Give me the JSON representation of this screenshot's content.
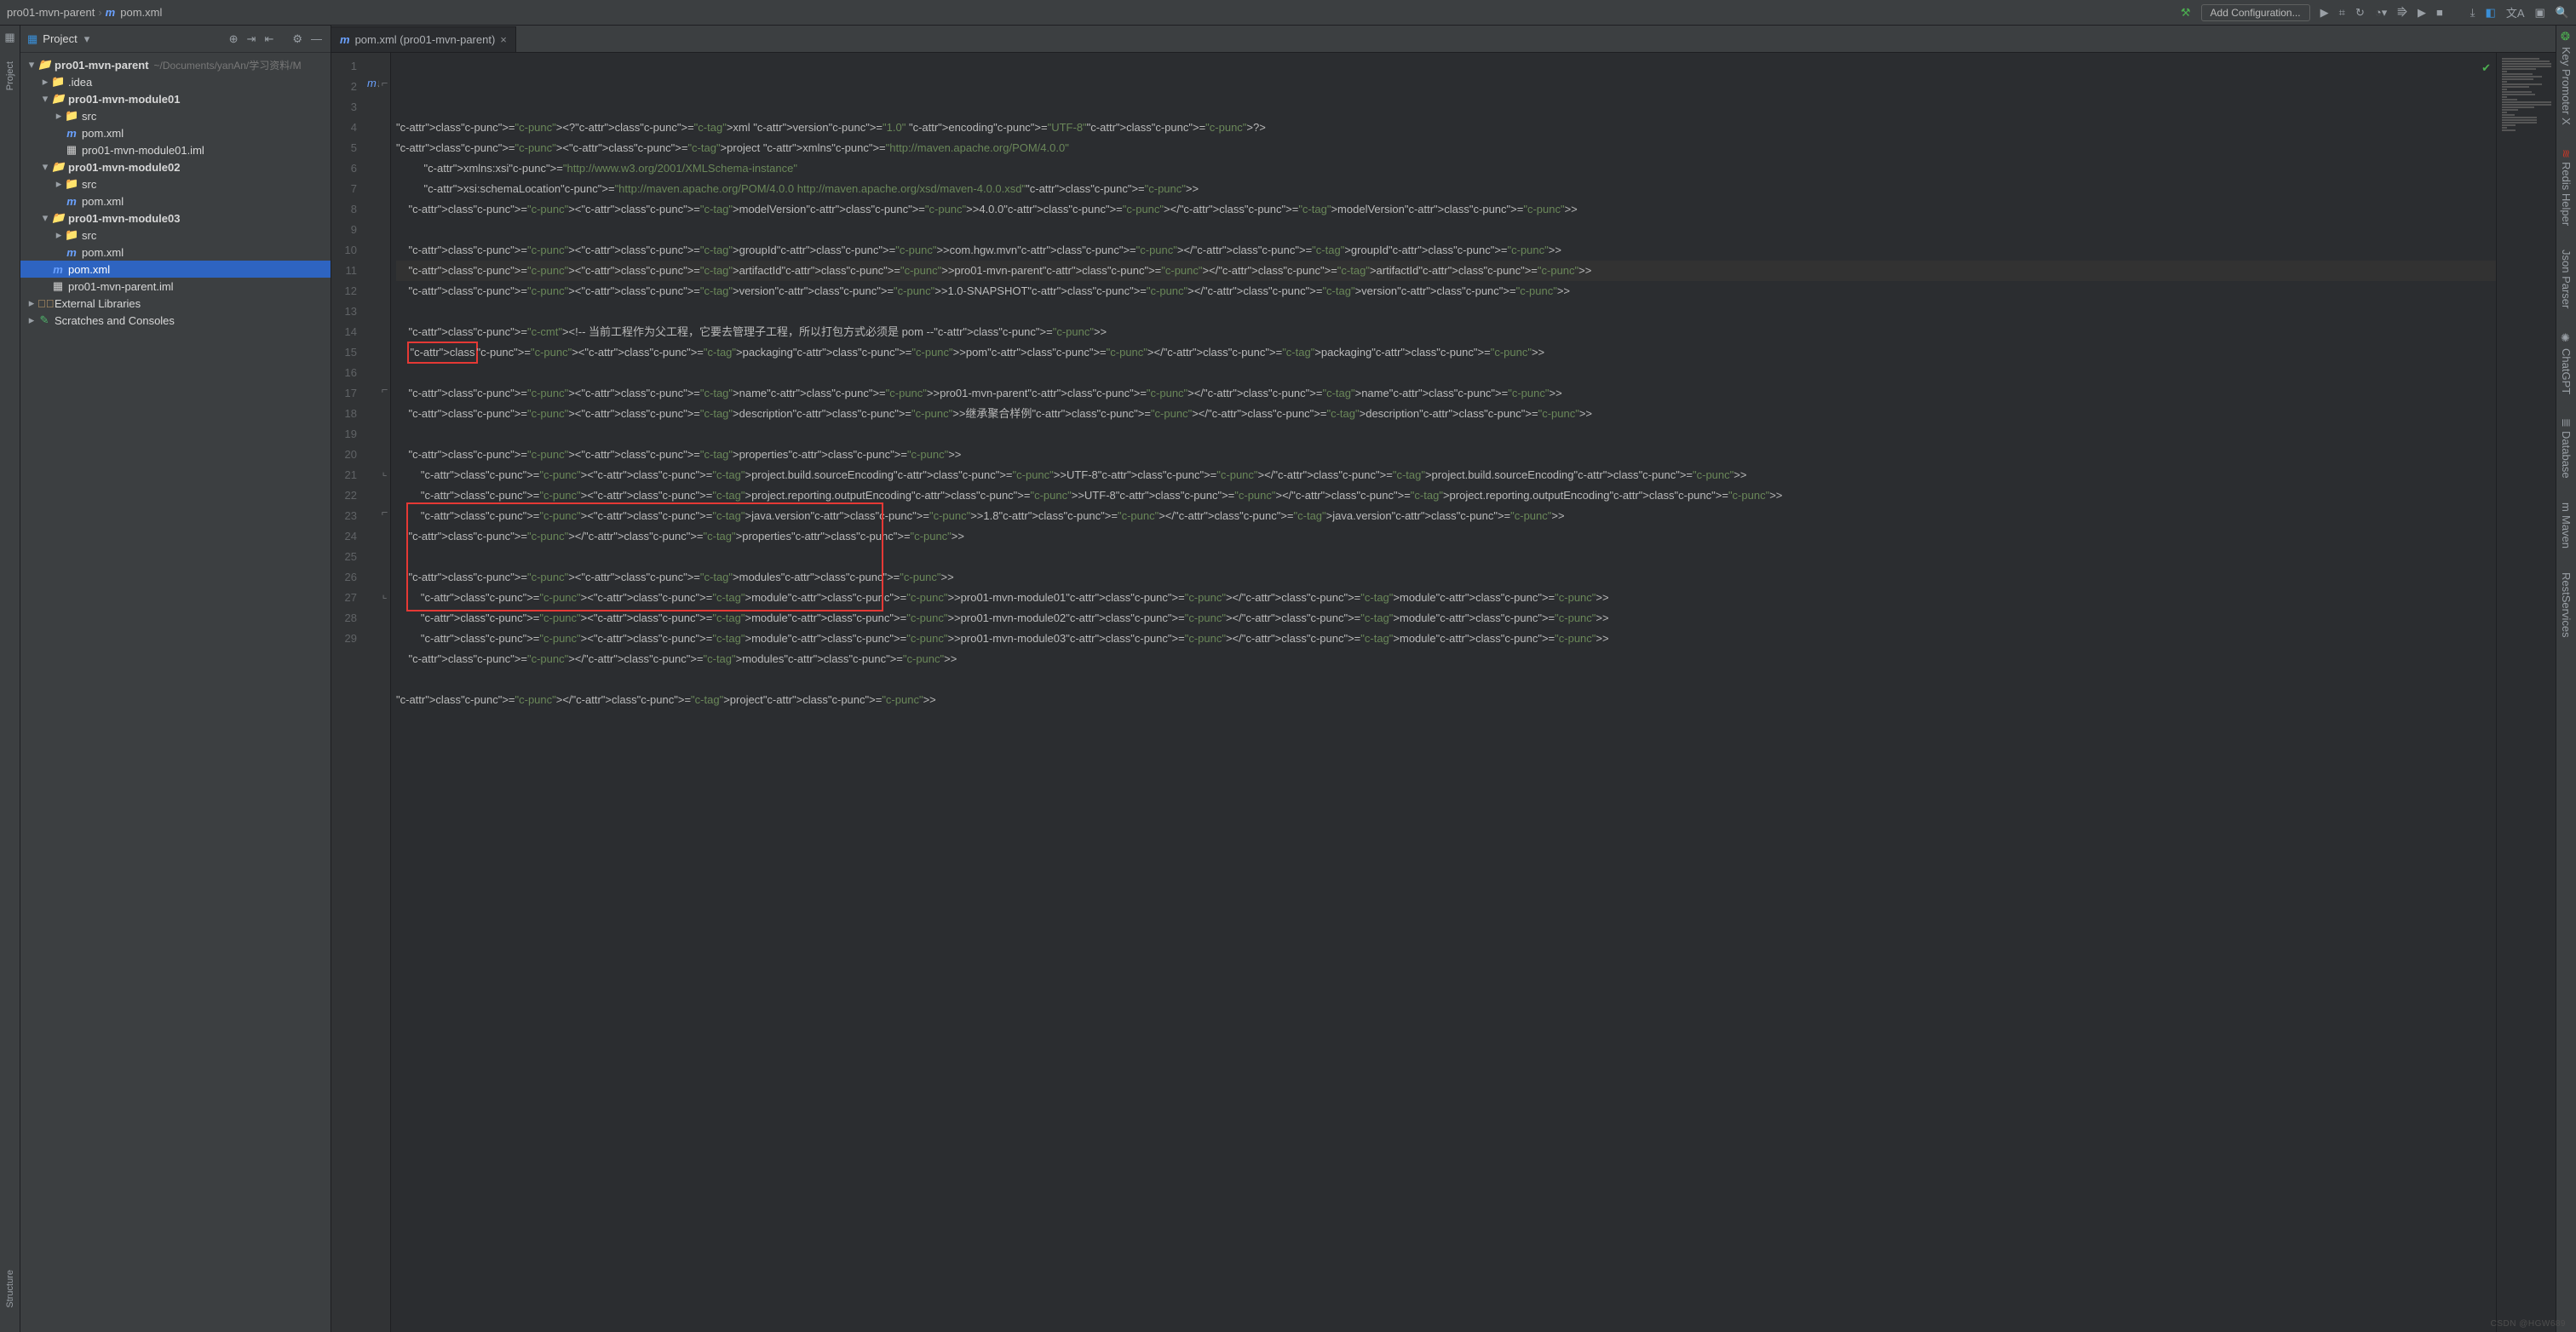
{
  "breadcrumb": {
    "root": "pro01-mvn-parent",
    "file": "pom.xml"
  },
  "toolbar": {
    "add_config": "Add Configuration..."
  },
  "sidebar": {
    "title": "Project",
    "root": {
      "name": "pro01-mvn-parent",
      "hint": "~/Documents/yanAn/学习资料/M"
    },
    "items": [
      {
        "type": "arrow-open",
        "indent": 0,
        "icon": "mod",
        "label": "pro01-mvn-parent",
        "bold": true,
        "hint": "~/Documents/yanAn/学习资料/M"
      },
      {
        "type": "arrow-closed",
        "indent": 1,
        "icon": "folder",
        "label": ".idea"
      },
      {
        "type": "arrow-open",
        "indent": 1,
        "icon": "mod",
        "label": "pro01-mvn-module01",
        "bold": true
      },
      {
        "type": "arrow-closed",
        "indent": 2,
        "icon": "folder",
        "label": "src"
      },
      {
        "type": "leaf",
        "indent": 2,
        "icon": "m",
        "label": "pom.xml"
      },
      {
        "type": "leaf",
        "indent": 2,
        "icon": "i",
        "label": "pro01-mvn-module01.iml"
      },
      {
        "type": "arrow-open",
        "indent": 1,
        "icon": "mod",
        "label": "pro01-mvn-module02",
        "bold": true
      },
      {
        "type": "arrow-closed",
        "indent": 2,
        "icon": "folder",
        "label": "src"
      },
      {
        "type": "leaf",
        "indent": 2,
        "icon": "m",
        "label": "pom.xml"
      },
      {
        "type": "arrow-open",
        "indent": 1,
        "icon": "mod",
        "label": "pro01-mvn-module03",
        "bold": true
      },
      {
        "type": "arrow-closed",
        "indent": 2,
        "icon": "folder",
        "label": "src"
      },
      {
        "type": "leaf",
        "indent": 2,
        "icon": "m",
        "label": "pom.xml"
      },
      {
        "type": "leaf",
        "indent": 1,
        "icon": "m",
        "label": "pom.xml",
        "selected": true
      },
      {
        "type": "leaf",
        "indent": 1,
        "icon": "i",
        "label": "pro01-mvn-parent.iml"
      },
      {
        "type": "arrow-closed",
        "indent": 0,
        "icon": "lib",
        "label": "External Libraries"
      },
      {
        "type": "arrow-closed",
        "indent": 0,
        "icon": "scr",
        "label": "Scratches and Consoles"
      }
    ]
  },
  "tab": {
    "label": "pom.xml (pro01-mvn-parent)"
  },
  "left_tool_labels": [
    "Project",
    "Structure"
  ],
  "right_tool_labels": [
    "Key Promoter X",
    "Redis Helper",
    "Json Parser",
    "ChatGPT",
    "Database",
    "Maven",
    "RestServices"
  ],
  "watermark": "CSDN @HGW689",
  "code": {
    "lines": [
      "<?xml version=\"1.0\" encoding=\"UTF-8\"?>",
      "<project xmlns=\"http://maven.apache.org/POM/4.0.0\"",
      "         xmlns:xsi=\"http://www.w3.org/2001/XMLSchema-instance\"",
      "         xsi:schemaLocation=\"http://maven.apache.org/POM/4.0.0 http://maven.apache.org/xsd/maven-4.0.0.xsd\">",
      "    <modelVersion>4.0.0</modelVersion>",
      "",
      "    <groupId>com.hgw.mvn</groupId>",
      "    <artifactId>pro01-mvn-parent</artifactId>",
      "    <version>1.0-SNAPSHOT</version>",
      "",
      "    <!-- 当前工程作为父工程，它要去管理子工程，所以打包方式必须是 pom -->",
      "    <packaging>pom</packaging>",
      "",
      "    <name>pro01-mvn-parent</name>",
      "    <description>继承聚合样例</description>",
      "",
      "    <properties>",
      "        <project.build.sourceEncoding>UTF-8</project.build.sourceEncoding>",
      "        <project.reporting.outputEncoding>UTF-8</project.reporting.outputEncoding>",
      "        <java.version>1.8</java.version>",
      "    </properties>",
      "",
      "    <modules>",
      "        <module>pro01-mvn-module01</module>",
      "        <module>pro01-mvn-module02</module>",
      "        <module>pro01-mvn-module03</module>",
      "    </modules>",
      "",
      "</project>"
    ],
    "current_line": 8,
    "highlight_tag_on_line8": "artifactId",
    "red_box_single_line": 12,
    "red_box_block_start": 23,
    "red_box_block_end": 27,
    "fold_open_lines": [
      2,
      17,
      21,
      23,
      27
    ],
    "mark_line2": "m↓"
  }
}
